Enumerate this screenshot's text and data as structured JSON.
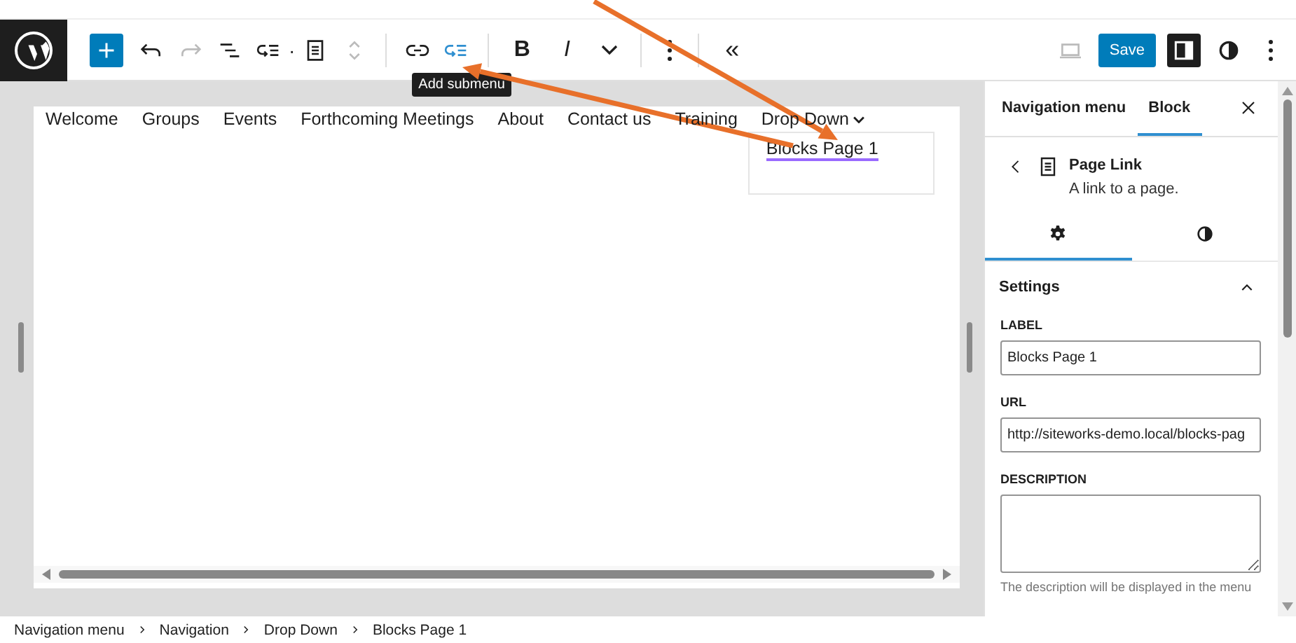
{
  "toolbar": {
    "separator": "·",
    "redo": {
      "disabled": true
    },
    "add_submenu": {
      "active": true,
      "tooltip": "Add submenu"
    },
    "bold": "B",
    "italic": "I",
    "collapse": "«"
  },
  "header_right": {
    "save": "Save",
    "sidebar_toggle": {
      "pressed": true
    }
  },
  "navigation": {
    "items": [
      {
        "label": "Welcome"
      },
      {
        "label": "Groups"
      },
      {
        "label": "Events"
      },
      {
        "label": "Forthcoming Meetings"
      },
      {
        "label": "About"
      },
      {
        "label": "Contact us"
      },
      {
        "label": "Training"
      },
      {
        "label": "Drop Down",
        "has_submenu": true
      }
    ],
    "submenu": [
      {
        "label": "Blocks Page 1",
        "selected": true
      }
    ]
  },
  "sidebar": {
    "tabs": [
      {
        "label": "Navigation menu",
        "selected": false
      },
      {
        "label": "Block",
        "selected": true
      }
    ],
    "block": {
      "title": "Page Link",
      "description": "A link to a page."
    },
    "subtabs": [
      {
        "selected": true
      },
      {
        "selected": false
      }
    ],
    "panel": {
      "title": "Settings",
      "expanded": true,
      "fields": [
        {
          "label": "LABEL",
          "value": "Blocks Page 1"
        },
        {
          "label": "URL",
          "value": "http://siteworks-demo.local/blocks-pag"
        },
        {
          "label": "DESCRIPTION",
          "multiline": true
        }
      ],
      "help": "The description will be displayed in the menu"
    }
  },
  "breadcrumb": [
    "Navigation menu",
    "Navigation",
    "Drop Down",
    "Blocks Page 1"
  ]
}
